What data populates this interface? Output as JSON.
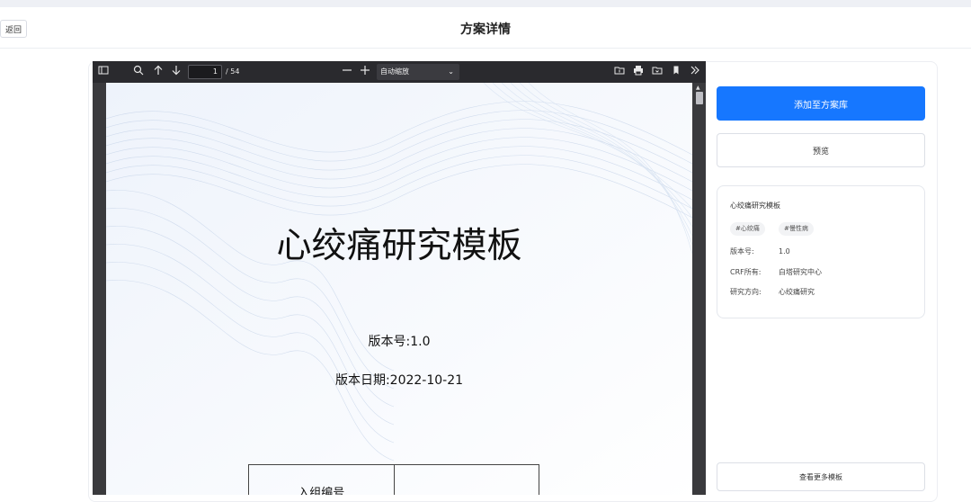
{
  "header": {
    "back_label": "返回",
    "title": "方案详情"
  },
  "viewer": {
    "toolbar": {
      "current_page": "1",
      "total_pages": "/ 54",
      "zoom_value": "自动缩放",
      "icons": [
        "sidebar-toggle-icon",
        "search-icon",
        "arrow-up-icon",
        "arrow-down-icon",
        "zoom-out-icon",
        "zoom-in-icon",
        "open-file-icon",
        "print-icon",
        "save-icon",
        "bookmark-icon",
        "more-tools-icon"
      ]
    },
    "document": {
      "title": "心绞痛研究模板",
      "version_line": "版本号:1.0",
      "date_line": "版本日期:2022-10-21",
      "table_header": "入组编号"
    }
  },
  "panel": {
    "add_button": "添加至方案库",
    "preview_button": "预览",
    "info": {
      "name": "心绞痛研究模板",
      "tags": [
        "#心绞痛",
        "#慢性病"
      ],
      "version_label": "版本号:",
      "version_value": "1.0",
      "owner_label": "CRF所有:",
      "owner_value": "白塔研究中心",
      "direction_label": "研究方向:",
      "direction_value": "心绞痛研究"
    },
    "more_button": "查看更多模板"
  },
  "colors": {
    "primary": "#1677ff",
    "viewer_bg": "#3a3a3d",
    "toolbar_bg": "#2a2a2e"
  }
}
